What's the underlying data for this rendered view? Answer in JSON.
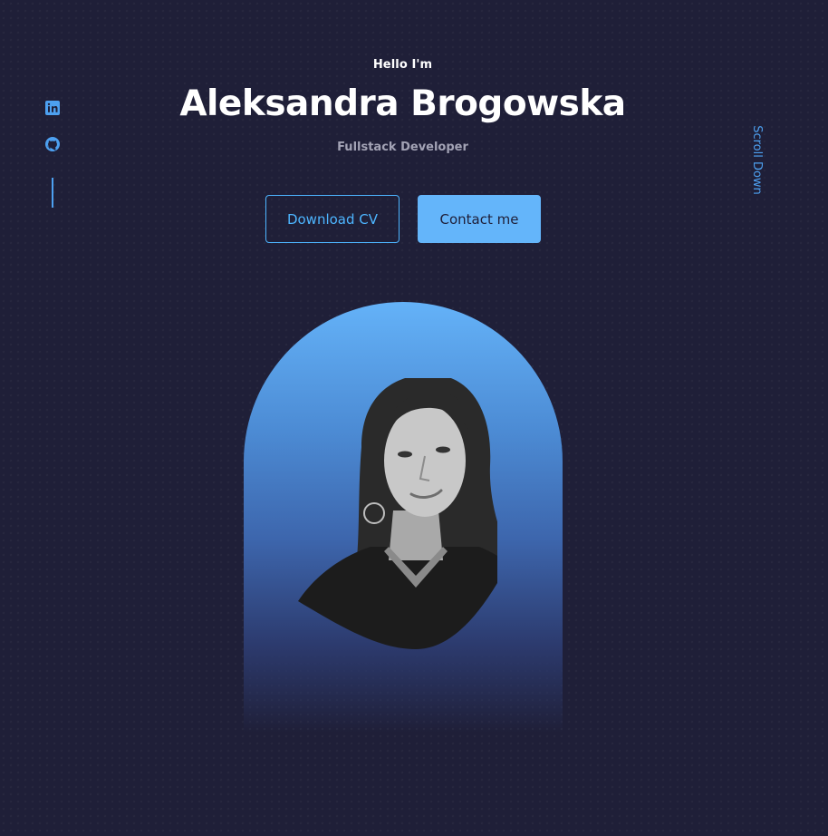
{
  "header": {
    "greeting": "Hello I'm",
    "name": "Aleksandra Brogowska",
    "role": "Fullstack Developer"
  },
  "actions": {
    "download_cv": "Download CV",
    "contact": "Contact me"
  },
  "socials": {
    "items": [
      {
        "icon": "linkedin-icon"
      },
      {
        "icon": "github-icon"
      }
    ]
  },
  "scroll": {
    "label": "Scroll Down"
  },
  "colors": {
    "background": "#1f1f38",
    "accent": "#4db5ff",
    "primary_button": "#64b5fa",
    "muted_text": "#a3a3b5"
  }
}
